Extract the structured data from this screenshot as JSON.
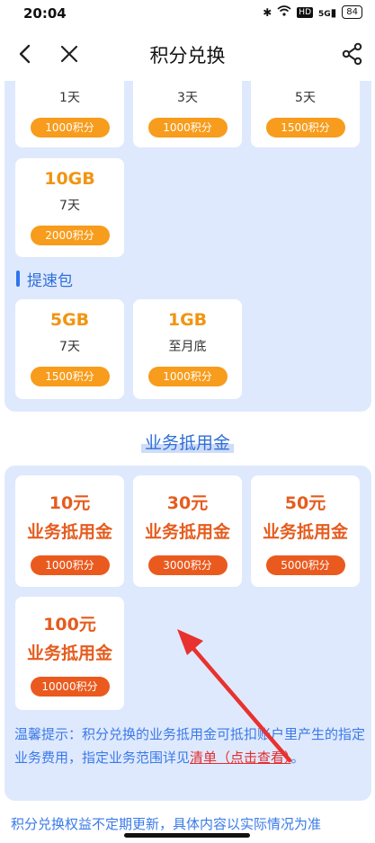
{
  "status": {
    "time": "20:04",
    "battery": "84",
    "hd": "HD",
    "signal": "5G"
  },
  "nav": {
    "title": "积分兑换"
  },
  "top_row": [
    {
      "duration": "1天",
      "points": "1000积分"
    },
    {
      "duration": "3天",
      "points": "1000积分"
    },
    {
      "duration": "5天",
      "points": "1500积分"
    }
  ],
  "data_extra": {
    "name": "10GB",
    "duration": "7天",
    "points": "2000积分"
  },
  "speed_section": {
    "title": "提速包"
  },
  "speed_items": [
    {
      "name": "5GB",
      "duration": "7天",
      "points": "1500积分"
    },
    {
      "name": "1GB",
      "duration": "至月底",
      "points": "1000积分"
    }
  ],
  "voucher_section": {
    "title": "业务抵用金"
  },
  "vouchers": [
    {
      "amount": "10元",
      "label": "业务抵用金",
      "points": "1000积分"
    },
    {
      "amount": "30元",
      "label": "业务抵用金",
      "points": "3000积分"
    },
    {
      "amount": "50元",
      "label": "业务抵用金",
      "points": "5000积分"
    },
    {
      "amount": "100元",
      "label": "业务抵用金",
      "points": "10000积分"
    }
  ],
  "tip": {
    "text": "温馨提示：积分兑换的业务抵用金可抵扣账户里产生的指定业务费用，指定业务范围详见",
    "link": "清单（点击查看）",
    "end": "。"
  },
  "bottom_text": "积分兑换权益不定期更新，具体内容以实际情况为准",
  "colors": {
    "accent_blue": "#2f6fd8",
    "orange": "#f79c1c",
    "red_orange": "#ea5a1e",
    "panel_bg": "#dfe9fd",
    "arrow": "#e8322f"
  }
}
